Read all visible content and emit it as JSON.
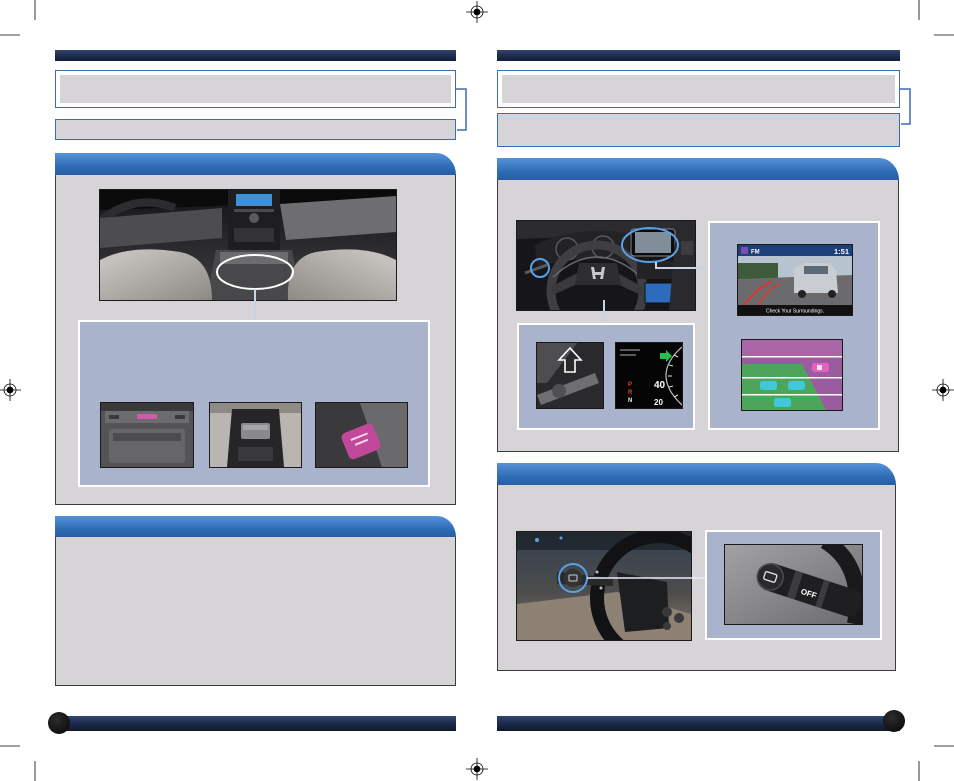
{
  "colors": {
    "header_bar": "#1c2b4d",
    "section_tab": "#2f6db5",
    "title_border": "#3b6db3",
    "panel_fill": "#d6d4d7",
    "inner_panel_fill": "#a9b3cc",
    "highlight_ring": "#5aa0e8"
  },
  "right_page": {
    "shift_display_photo": {
      "speed_upper": "40",
      "speed_lower": "20",
      "gear_park": "P",
      "gear_reverse": "R",
      "gear_neutral": "N"
    },
    "camera_display_photo": {
      "audio_band": "FM",
      "clock": "1:51",
      "caption": "Check Your Surroundings."
    },
    "stalk_closeup_photo": {
      "switch_label": "OFF"
    }
  }
}
